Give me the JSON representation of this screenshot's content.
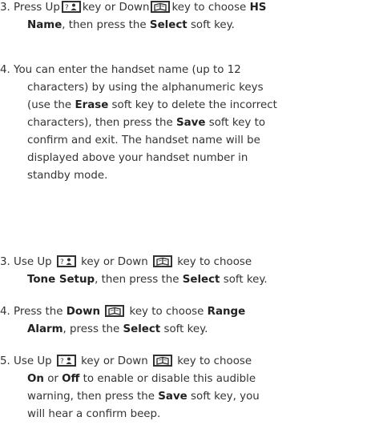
{
  "sec1": {
    "i3": {
      "n": "3.",
      "a": "Press Up",
      "b": "key or Down",
      "c": "key to choose",
      "hs": "HS",
      "name": "Name",
      "d": ", then press the",
      "select": "Select",
      "e": "soft key."
    },
    "i4": {
      "n": "4.",
      "l1": "You can enter the handset name (up to 12",
      "l2": "characters) by using the alphanumeric keys",
      "l3a": "(use the",
      "erase": "Erase",
      "l3b": "soft key to delete the incorrect",
      "l4a": "characters), then press the",
      "save": "Save",
      "l4b": "soft key to",
      "l5": "confirm and exit. The handset name will be",
      "l6": "displayed above your handset number in",
      "l7": "standby mode."
    }
  },
  "sec2": {
    "i3": {
      "n": "3.",
      "a": "Use Up",
      "b": "key or Down",
      "c": "key to choose",
      "tone": "Tone Setup",
      "d": ", then press the",
      "select": "Select",
      "e": "soft key."
    },
    "i4": {
      "n": "4.",
      "a": "Press the",
      "down": "Down",
      "b": "key to choose",
      "range": "Range",
      "alarm": "Alarm",
      "c": ", press the",
      "select": "Select",
      "d": "soft key."
    },
    "i5": {
      "n": "5.",
      "a": "Use Up",
      "b": "key or Down",
      "c": "key to choose",
      "on": "On",
      "or": "or",
      "off": "Off",
      "d": "to enable or disable this audible",
      "l3a": "warning, then press the",
      "save": "Save",
      "l3b": "soft key, you",
      "l4": "will hear a confirm beep."
    }
  },
  "icons": {
    "up": "phonebook-person-key-icon",
    "down": "open-book-key-icon"
  },
  "colors": {
    "text": "#333333",
    "bold": "#222222"
  }
}
